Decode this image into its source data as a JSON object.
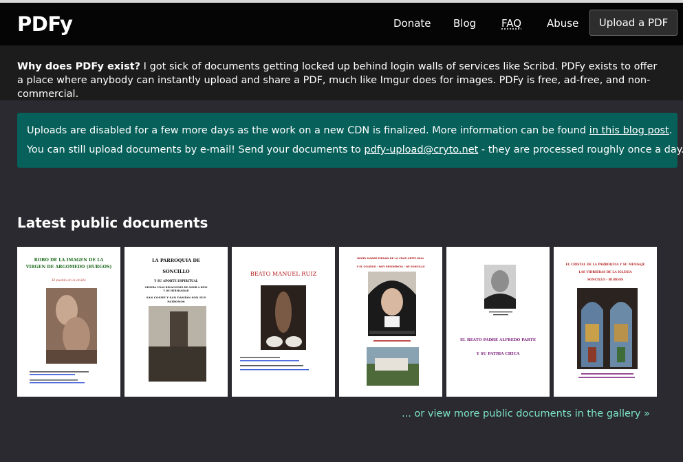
{
  "nav": {
    "brand": "PDFy",
    "links": [
      "Donate",
      "Blog",
      "FAQ",
      "Abuse"
    ],
    "upload": "Upload a PDF"
  },
  "about": {
    "lead": "Why does PDFy exist?",
    "text": " I got sick of documents getting locked up behind login walls of services like Scribd. PDFy exists to offer a place where anybody can instantly upload and share a PDF, much like Imgur does for images. PDFy is free, ad-free, and non-commercial."
  },
  "notice": {
    "line1_pre": "Uploads are disabled for a few more days as the work on a new CDN is finalized. More information can be found ",
    "line1_link": "in this blog post",
    "line1_post": ".",
    "line2_pre": "You can still upload documents by e-mail! Send your documents to ",
    "line2_link": "pdfy-upload@cryto.net",
    "line2_post": " - they are processed roughly once a day."
  },
  "latest": {
    "title": "Latest public documents",
    "more": "... or view more public documents in the gallery »"
  },
  "documents": [
    {
      "lines": [
        "ROBO DE LA IMAGEN DE LA",
        "VIRGEN DE ARGOMEDO (BURGOS)"
      ],
      "subtitle": "El pueblo en la olvido",
      "title_color": "#1f6b1f"
    },
    {
      "lines": [
        "LA PARROQUIA DE",
        "SONCILLO",
        "Y SU APORTE ESPIRITUAL",
        "GENERA UNAS RELACIONES DE AMOR A DIOS",
        "Y DE HERMANDAD",
        "SAN COSME Y SAN DAMIÁN SON SUS",
        "PATRONOS"
      ],
      "title_color": "#111111"
    },
    {
      "lines": [
        "BEATO MANUEL RUIZ"
      ],
      "title_color": "#b52020"
    },
    {
      "lines": [
        "BEATA MADRE PIEDAD DE LA CRUZ ORTIZ REAL",
        "Y EL COLEGIO - HOY RESIDENCIA - DE SONCILLO"
      ],
      "title_color": "#b52020"
    },
    {
      "lines": [
        "EL BEATO PADRE ALFREDO PARTE",
        "Y SU PATRIA CHICA"
      ],
      "title_color": "#7b1f7b"
    },
    {
      "lines": [
        "EL CRISTAL DE LA PARROQUIA Y SU MENSAJE",
        "LAS VIDRIERAS DE LA IGLESIA",
        "SONCILLO - BURGOS"
      ],
      "title_color": "#b52020"
    }
  ]
}
